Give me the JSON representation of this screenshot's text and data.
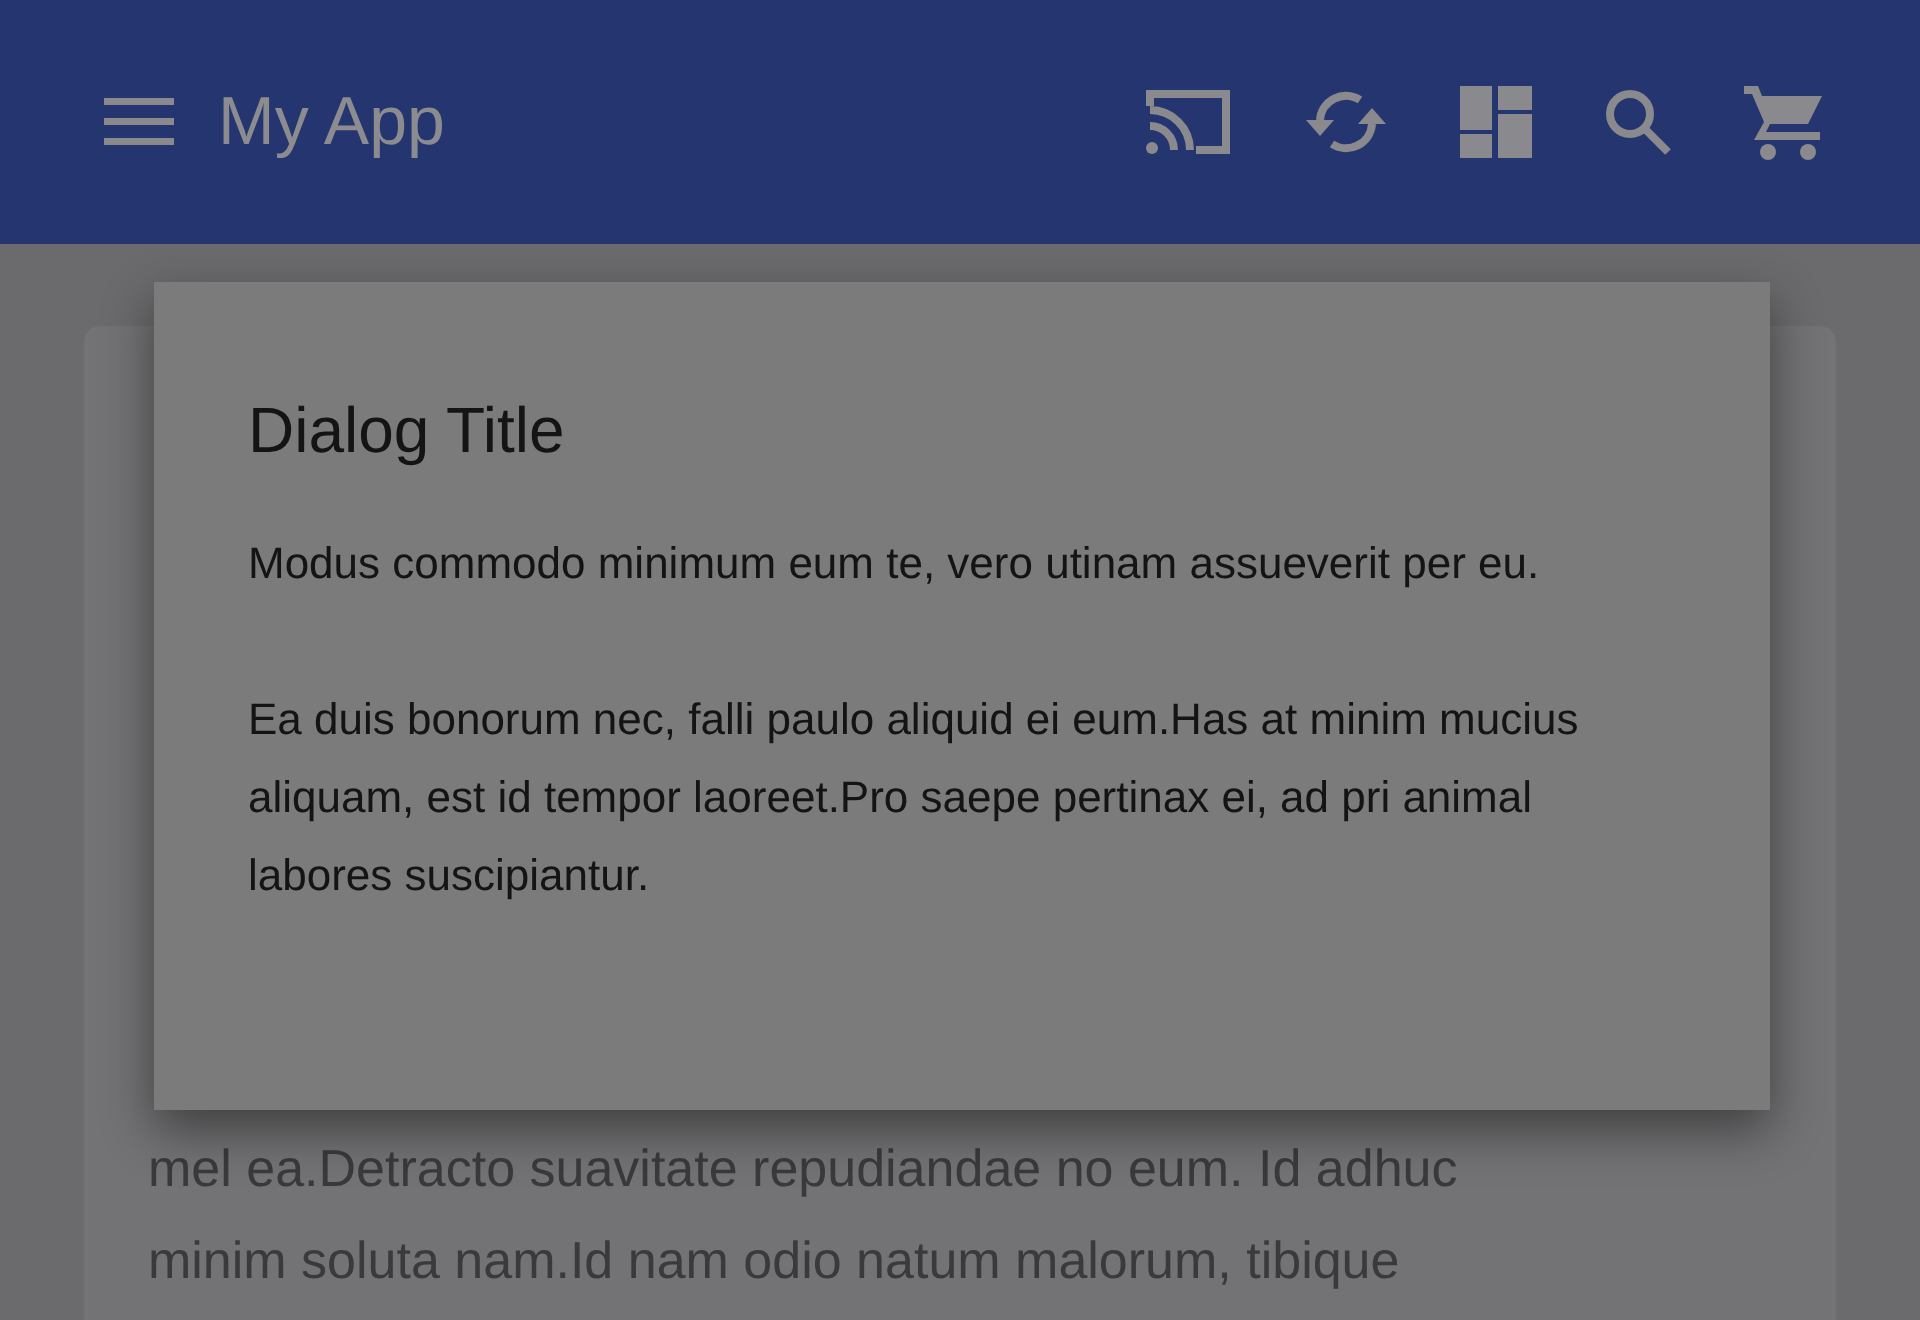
{
  "app_bar": {
    "title": "My App"
  },
  "card": {
    "lines": [
      "mel ea.Detracto suavitate repudiandae no eum. Id adhuc",
      "minim soluta nam.Id nam odio natum malorum, tibique"
    ]
  },
  "dialog": {
    "title": "Dialog Title",
    "paragraphs": [
      "Modus commodo minimum eum te, vero utinam assueverit per eu.",
      "Ea duis bonorum nec, falli paulo aliquid ei eum.Has at minim mucius aliquam, est id tempor laoreet.Pro saepe pertinax ei, ad pri animal labores suscipiantur."
    ]
  }
}
